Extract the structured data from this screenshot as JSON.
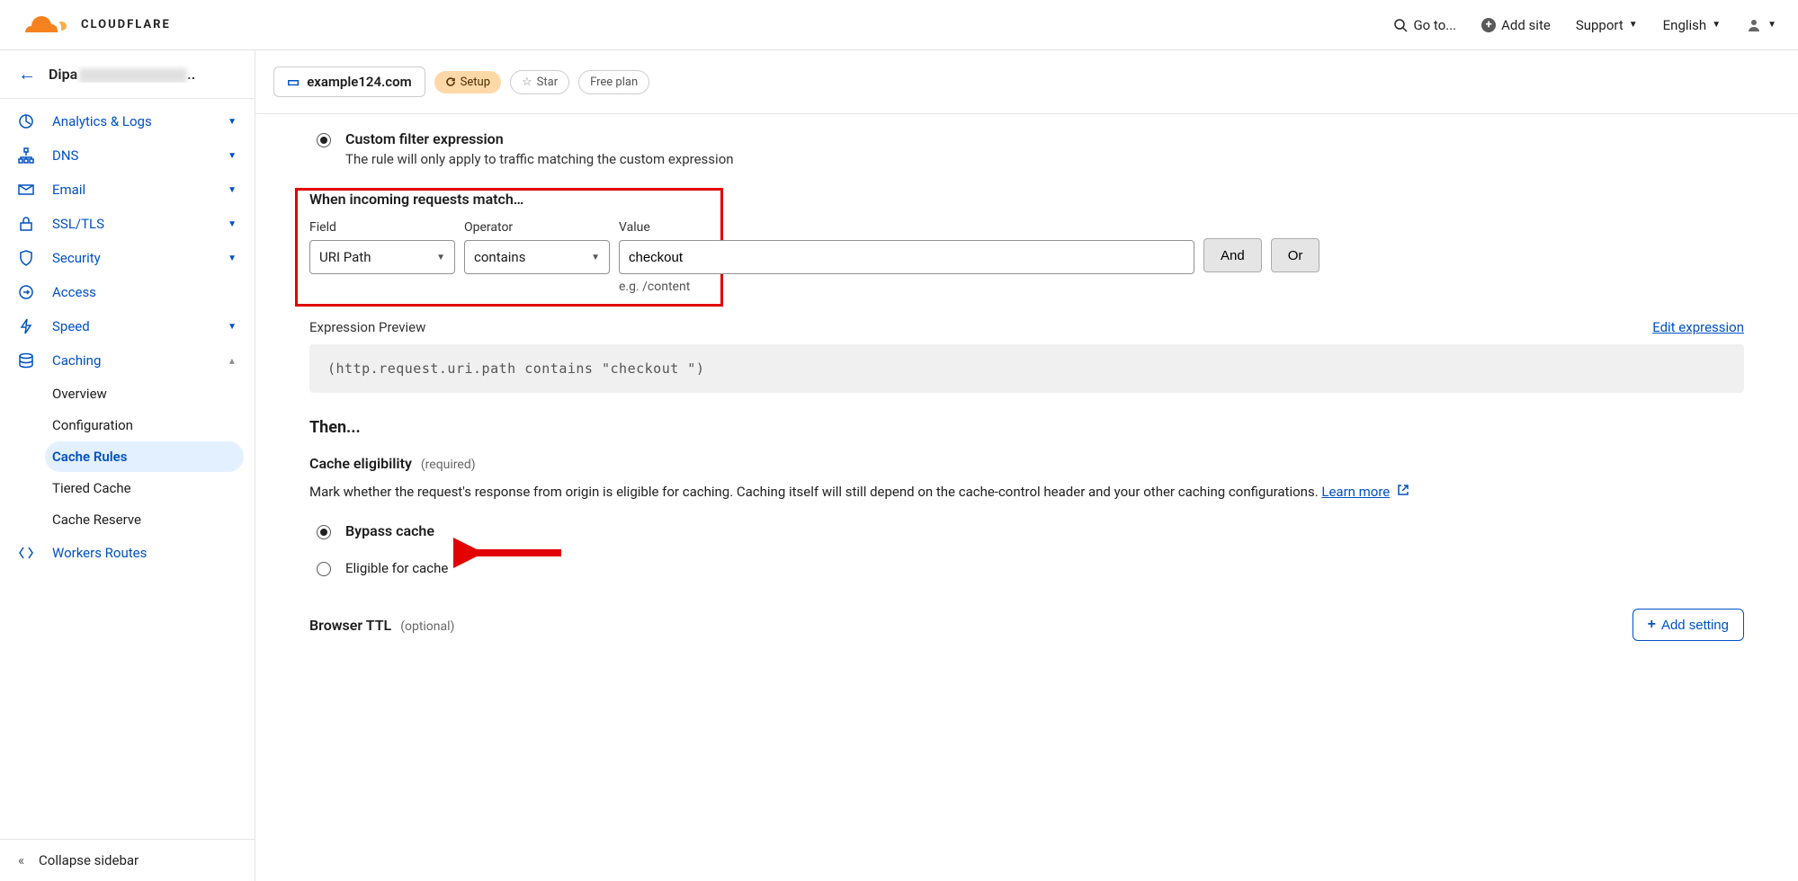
{
  "header": {
    "logo_text": "CLOUDFLARE",
    "goto": "Go to...",
    "add_site": "Add site",
    "support": "Support",
    "language": "English"
  },
  "sidebar": {
    "account_prefix": "Dipa",
    "account_suffix": "..",
    "items": [
      {
        "icon": "analytics",
        "label": "Analytics & Logs",
        "caret": true
      },
      {
        "icon": "dns",
        "label": "DNS",
        "caret": true
      },
      {
        "icon": "email",
        "label": "Email",
        "caret": true
      },
      {
        "icon": "lock",
        "label": "SSL/TLS",
        "caret": true
      },
      {
        "icon": "shield",
        "label": "Security",
        "caret": true
      },
      {
        "icon": "access",
        "label": "Access",
        "caret": false
      },
      {
        "icon": "bolt",
        "label": "Speed",
        "caret": true
      },
      {
        "icon": "caching",
        "label": "Caching",
        "caret": true,
        "expanded": true
      }
    ],
    "caching_sub": [
      "Overview",
      "Configuration",
      "Cache Rules",
      "Tiered Cache",
      "Cache Reserve"
    ],
    "workers": "Workers Routes",
    "collapse": "Collapse sidebar"
  },
  "content_header": {
    "site": "example124.com",
    "setup": "Setup",
    "star": "Star",
    "plan": "Free plan"
  },
  "main": {
    "custom_filter_label": "Custom filter expression",
    "custom_filter_desc": "The rule will only apply to traffic matching the custom expression",
    "match_heading": "When incoming requests match…",
    "field_label": "Field",
    "field_value": "URI Path",
    "operator_label": "Operator",
    "operator_value": "contains",
    "value_label": "Value",
    "value_value": "checkout",
    "value_hint": "e.g. /content",
    "and_btn": "And",
    "or_btn": "Or",
    "exp_preview_label": "Expression Preview",
    "edit_exp": "Edit expression",
    "expression_code": "(http.request.uri.path contains \"checkout \")",
    "then": "Then...",
    "cache_elig_title": "Cache eligibility",
    "required": "(required)",
    "cache_elig_desc": "Mark whether the request's response from origin is eligible for caching. Caching itself will still depend on the cache-control header and your other caching configurations. ",
    "learn_more": "Learn more",
    "bypass": "Bypass cache",
    "eligible": "Eligible for cache",
    "browser_ttl": "Browser TTL",
    "optional": "(optional)",
    "add_setting": "Add setting"
  }
}
